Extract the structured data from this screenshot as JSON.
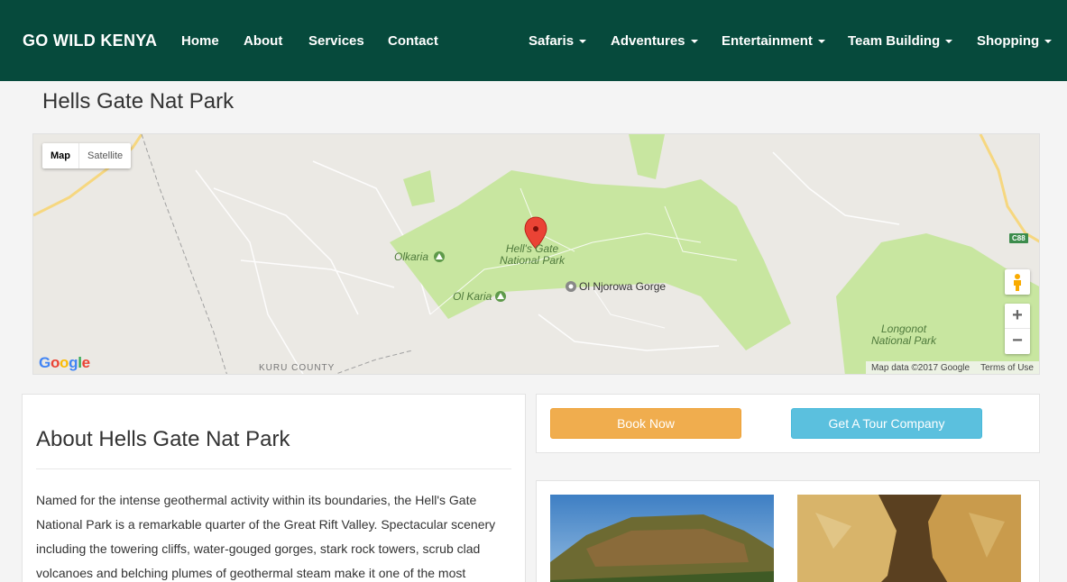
{
  "nav": {
    "brand": "GO WILD KENYA",
    "left_links": [
      "Home",
      "About",
      "Services",
      "Contact"
    ],
    "right_dropdowns": [
      "Safaris",
      "Adventures",
      "Entertainment",
      "Team Building",
      "Shopping"
    ]
  },
  "page": {
    "title": "Hells Gate Nat Park"
  },
  "map": {
    "type_buttons": [
      "Map",
      "Satellite"
    ],
    "active_type": "Map",
    "marker_label": [
      "Hell's Gate",
      "National Park"
    ],
    "places": {
      "olkaria": "Olkaria",
      "ol_karia": "Ol Karia",
      "gorge": "Ol Njorowa Gorge",
      "longonot": [
        "Longonot",
        "National Park"
      ],
      "county": "KURU COUNTY",
      "road_badge": "C88"
    },
    "zoom_in": "+",
    "zoom_out": "−",
    "logo": "Google",
    "attribution": "Map data ©2017 Google",
    "terms": "Terms of Use"
  },
  "about": {
    "heading": "About Hells Gate Nat Park",
    "lines": [
      "Named for the intense geothermal activity within its boundaries, the Hell's Gate",
      "National Park is a remarkable quarter of the Great Rift Valley. Spectacular scenery",
      "including the towering cliffs, water-gouged gorges, stark rock towers, scrub clad",
      "volcanoes and belching plumes of geothermal steam make it one of the most"
    ]
  },
  "actions": {
    "book_label": "Book Now",
    "tour_label": "Get A Tour Company"
  },
  "colors": {
    "navbar": "#064a3c",
    "book": "#f0ad4e",
    "tour": "#5bc0de",
    "park_green": "#c8e6a0"
  }
}
